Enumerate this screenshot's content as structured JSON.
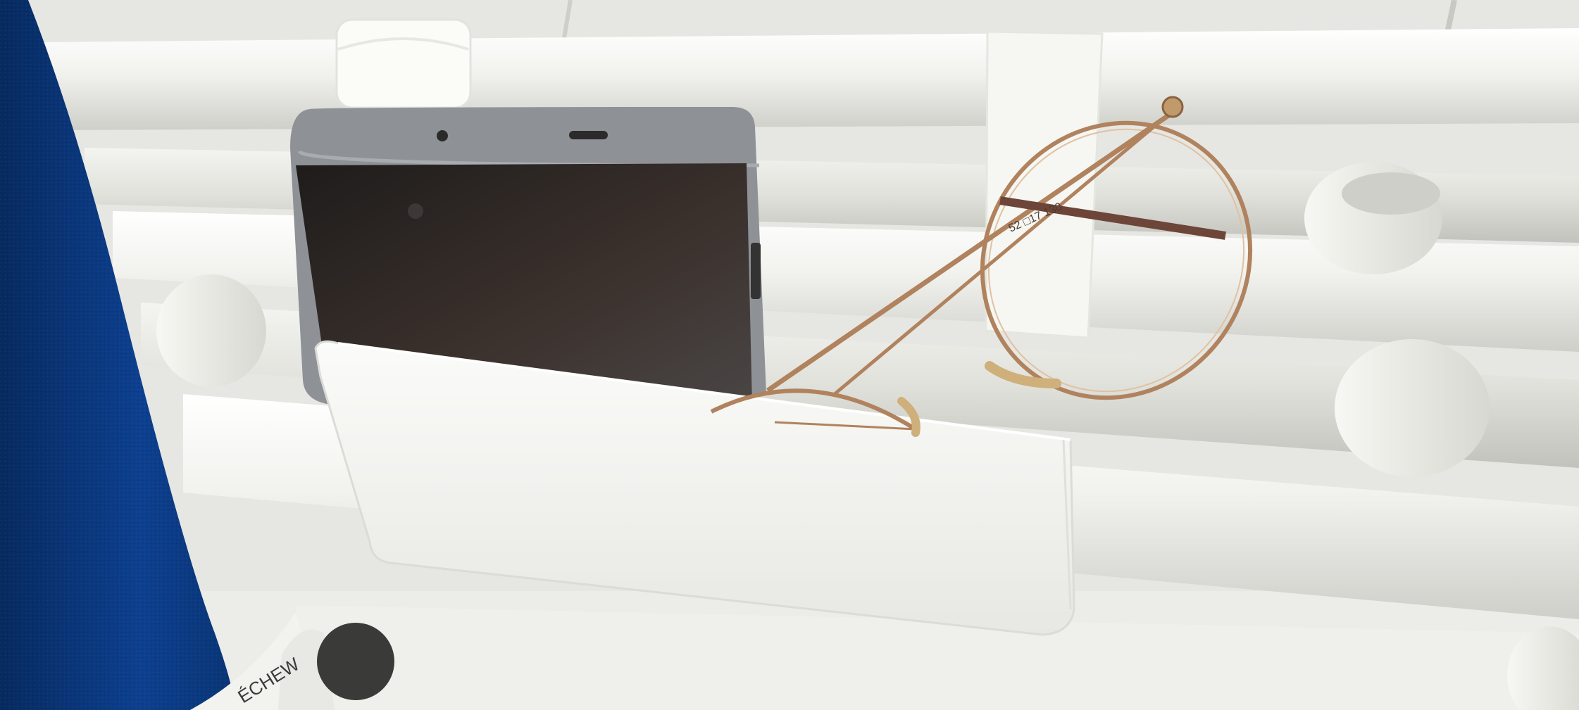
{
  "photo": {
    "subject": "3D-printed holder on towel radiator",
    "towel_label_text": "ÉCHEW",
    "glasses_temple_text": "52 □17 130",
    "colors": {
      "wall_tile": "#e9e9e6",
      "radiator_bar": "#f0f0ec",
      "holder": "#f4f4f1",
      "device_frame": "#8c8f93",
      "device_screen": "#2a2624",
      "glasses_frame": "#b0825d",
      "towel": "#0b3b80"
    }
  }
}
